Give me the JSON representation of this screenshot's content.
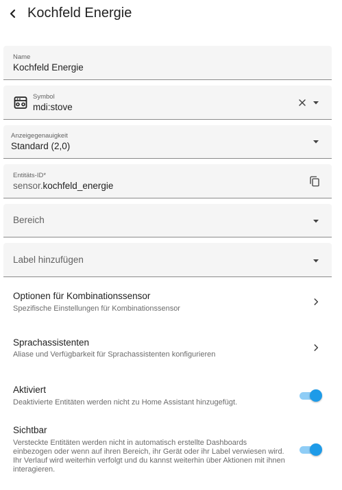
{
  "header": {
    "title": "Kochfeld Energie",
    "back_icon": "chevron-left-icon"
  },
  "form": {
    "name": {
      "label": "Name",
      "value": "Kochfeld Energie"
    },
    "symbol": {
      "label": "Symbol",
      "value": "mdi:stove",
      "icon": "stove-icon"
    },
    "precision": {
      "label": "Anzeigegenauigkeit",
      "value": "Standard (2,0)"
    },
    "entity_id": {
      "label": "Entitäts-ID*",
      "prefix": "sensor.",
      "value": "kochfeld_energie"
    },
    "area": {
      "placeholder": "Bereich"
    },
    "labels": {
      "placeholder": "Label hinzufügen"
    }
  },
  "options": [
    {
      "title": "Optionen für Kombinationssensor",
      "subtitle": "Spezifische Einstellungen für Kombinationssensor"
    },
    {
      "title": "Sprachassistenten",
      "subtitle": "Aliase und Verfügbarkeit für Sprachassistenten konfigurieren"
    }
  ],
  "toggles": {
    "enabled": {
      "title": "Aktiviert",
      "description": "Deaktivierte Entitäten werden nicht zu Home Assistant hinzugefügt.",
      "on": true
    },
    "visible": {
      "title": "Sichtbar",
      "description": "Versteckte Entitäten werden nicht in automatisch erstellte Dashboards einbezogen oder wenn auf ihren Bereich, ihr Gerät oder ihr Label verwiesen wird. Ihr Verlauf wird weiterhin verfolgt und du kannst weiterhin über Aktionen mit ihnen interagieren.",
      "on": true
    }
  },
  "colors": {
    "accent": "#1e9be8",
    "field_bg": "#f5f5f5"
  }
}
